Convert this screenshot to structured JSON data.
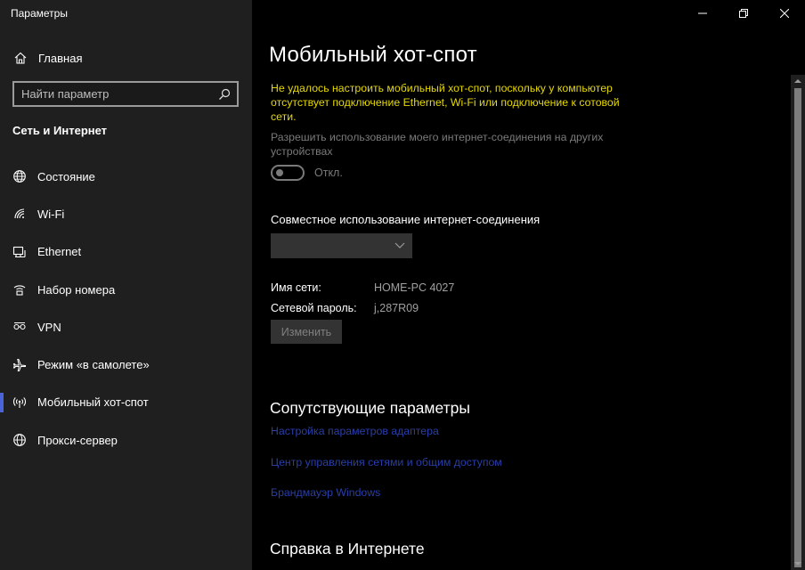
{
  "window": {
    "app_title": "Параметры"
  },
  "sidebar": {
    "home_label": "Главная",
    "search_placeholder": "Найти параметр",
    "section_title": "Сеть и Интернет",
    "items": [
      {
        "label": "Состояние",
        "icon": "globe-icon"
      },
      {
        "label": "Wi-Fi",
        "icon": "wifi-icon"
      },
      {
        "label": "Ethernet",
        "icon": "ethernet-icon"
      },
      {
        "label": "Набор номера",
        "icon": "dialup-icon"
      },
      {
        "label": "VPN",
        "icon": "vpn-icon"
      },
      {
        "label": "Режим «в самолете»",
        "icon": "airplane-icon"
      },
      {
        "label": "Мобильный хот-спот",
        "icon": "hotspot-icon",
        "active": true
      },
      {
        "label": "Прокси-сервер",
        "icon": "globe-icon"
      }
    ]
  },
  "main": {
    "title": "Мобильный хот-спот",
    "warning": "Не удалось настроить мобильный хот-спот, поскольку у компьютер отсутствует подключение Ethernet, Wi-Fi или подключение к сотовой сети.",
    "share_label": "Разрешить использование моего интернет-соединения на других устройствах",
    "toggle_state": "Откл.",
    "ics_label": "Совместное использование интернет-соединения",
    "dropdown_value": "",
    "network_name_label": "Имя сети:",
    "network_name_value": "HOME-PC 4027",
    "password_label": "Сетевой пароль:",
    "password_value": "j,287R09",
    "edit_button": "Изменить",
    "related_title": "Сопутствующие параметры",
    "links": [
      "Настройка параметров адаптера",
      "Центр управления сетями и общим доступом",
      "Брандмауэр Windows"
    ],
    "help_title": "Справка в Интернете"
  },
  "colors": {
    "sidebar_bg": "#1f1f1f",
    "main_bg": "#000000",
    "warning": "#e6d900",
    "link": "#2a3ea8",
    "accent": "#4a63d9"
  }
}
